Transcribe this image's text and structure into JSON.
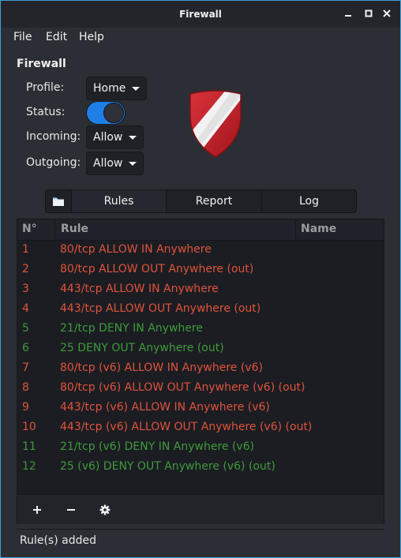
{
  "window": {
    "title": "Firewall"
  },
  "menubar": {
    "items": [
      "File",
      "Edit",
      "Help"
    ]
  },
  "firewall": {
    "section_title": "Firewall",
    "profile": {
      "label": "Profile:",
      "value": "Home"
    },
    "status": {
      "label": "Status:",
      "enabled": true
    },
    "incoming": {
      "label": "Incoming:",
      "value": "Allow"
    },
    "outgoing": {
      "label": "Outgoing:",
      "value": "Allow"
    }
  },
  "tabs": [
    {
      "icon": "folder-icon"
    },
    {
      "label": "Rules",
      "active": true
    },
    {
      "label": "Report"
    },
    {
      "label": "Log"
    }
  ],
  "table": {
    "columns": [
      "N°",
      "Rule",
      "Name"
    ],
    "rows": [
      {
        "num": "1",
        "rule": "80/tcp ALLOW IN Anywhere",
        "type": "allow"
      },
      {
        "num": "2",
        "rule": "80/tcp ALLOW OUT Anywhere (out)",
        "type": "allow"
      },
      {
        "num": "3",
        "rule": "443/tcp ALLOW IN Anywhere",
        "type": "allow"
      },
      {
        "num": "4",
        "rule": "443/tcp ALLOW OUT Anywhere (out)",
        "type": "allow"
      },
      {
        "num": "5",
        "rule": "21/tcp DENY IN Anywhere",
        "type": "deny"
      },
      {
        "num": "6",
        "rule": "25 DENY OUT Anywhere (out)",
        "type": "deny"
      },
      {
        "num": "7",
        "rule": "80/tcp (v6) ALLOW IN Anywhere (v6)",
        "type": "allow"
      },
      {
        "num": "8",
        "rule": "80/tcp (v6) ALLOW OUT Anywhere (v6) (out)",
        "type": "allow"
      },
      {
        "num": "9",
        "rule": "443/tcp (v6) ALLOW IN Anywhere (v6)",
        "type": "allow"
      },
      {
        "num": "10",
        "rule": "443/tcp (v6) ALLOW OUT Anywhere (v6) (out)",
        "type": "allow"
      },
      {
        "num": "11",
        "rule": "21/tcp (v6) DENY IN Anywhere (v6)",
        "type": "deny"
      },
      {
        "num": "12",
        "rule": "25 (v6) DENY OUT Anywhere (v6) (out)",
        "type": "deny"
      }
    ]
  },
  "toolbar": {
    "add_icon": "plus-icon",
    "remove_icon": "minus-icon",
    "settings_icon": "gear-icon"
  },
  "statusbar": {
    "text": "Rule(s) added"
  },
  "colors": {
    "allow": "#e0533a",
    "deny": "#3f9b3a",
    "accent": "#1f7fe6",
    "shield_red": "#c6262e"
  }
}
